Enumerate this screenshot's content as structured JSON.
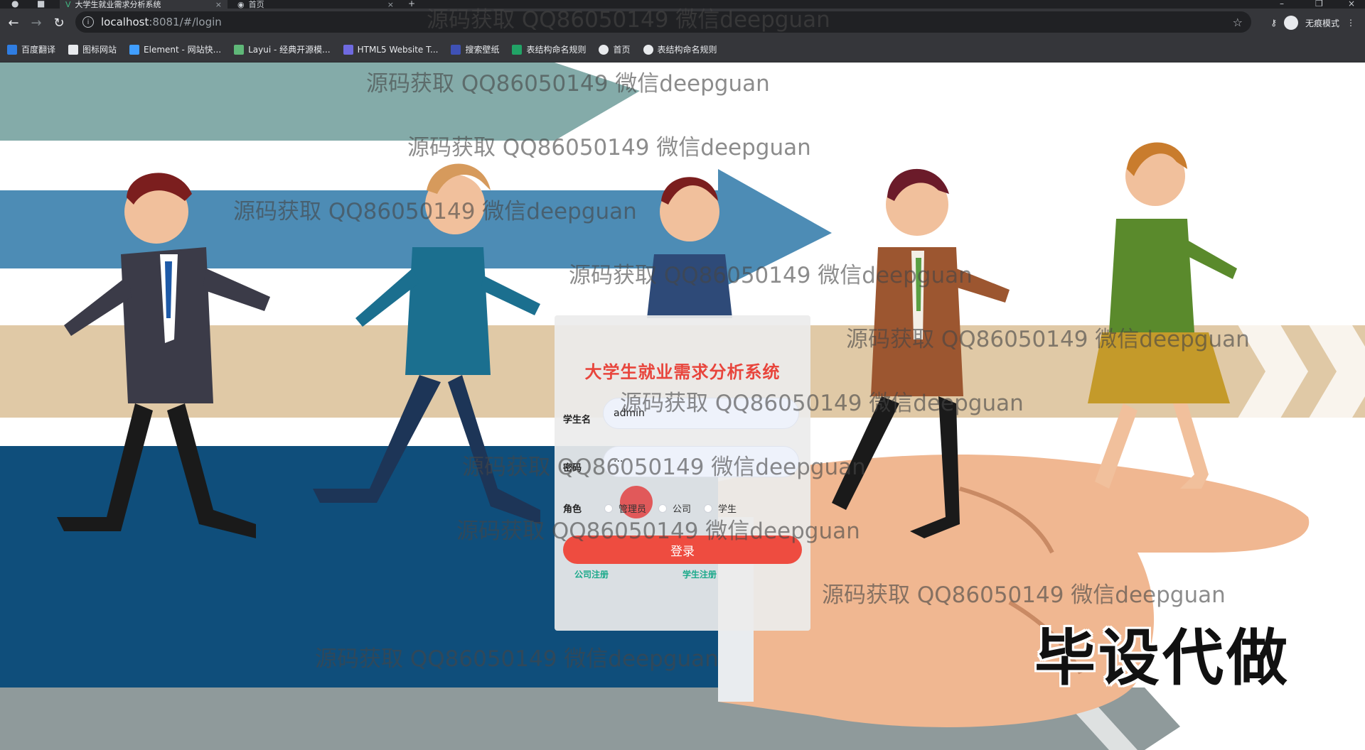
{
  "browser": {
    "tabs": [
      {
        "title": "大学生就业需求分析系统",
        "active": true
      },
      {
        "title": "首页",
        "active": false
      }
    ],
    "new_tab_label": "+",
    "url_host": "localhost",
    "url_path": ":8081/#/login",
    "profile_label": "无痕模式",
    "bookmarks": [
      "百度翻译",
      "图标网站",
      "Element - 网站快...",
      "Layui - 经典开源模...",
      "HTML5 Website T...",
      "搜索壁纸",
      "表结构命名规则",
      "首页",
      "表结构命名规则"
    ]
  },
  "login": {
    "title": "大学生就业需求分析系统",
    "username_label": "学生名",
    "username_value": "admin",
    "password_label": "密码",
    "password_value": "···",
    "role_label": "角色",
    "roles": [
      "管理员",
      "公司",
      "学生"
    ],
    "submit_label": "登录",
    "company_register": "公司注册",
    "student_register": "学生注册"
  },
  "watermark_text": "源码获取 QQ86050149 微信deepguan",
  "stamp_text": "毕设代做",
  "colors": {
    "accent_red": "#ee4c40",
    "title_red": "#e8453c",
    "link_green": "#1aa98a",
    "chrome_dark": "#35363a"
  }
}
